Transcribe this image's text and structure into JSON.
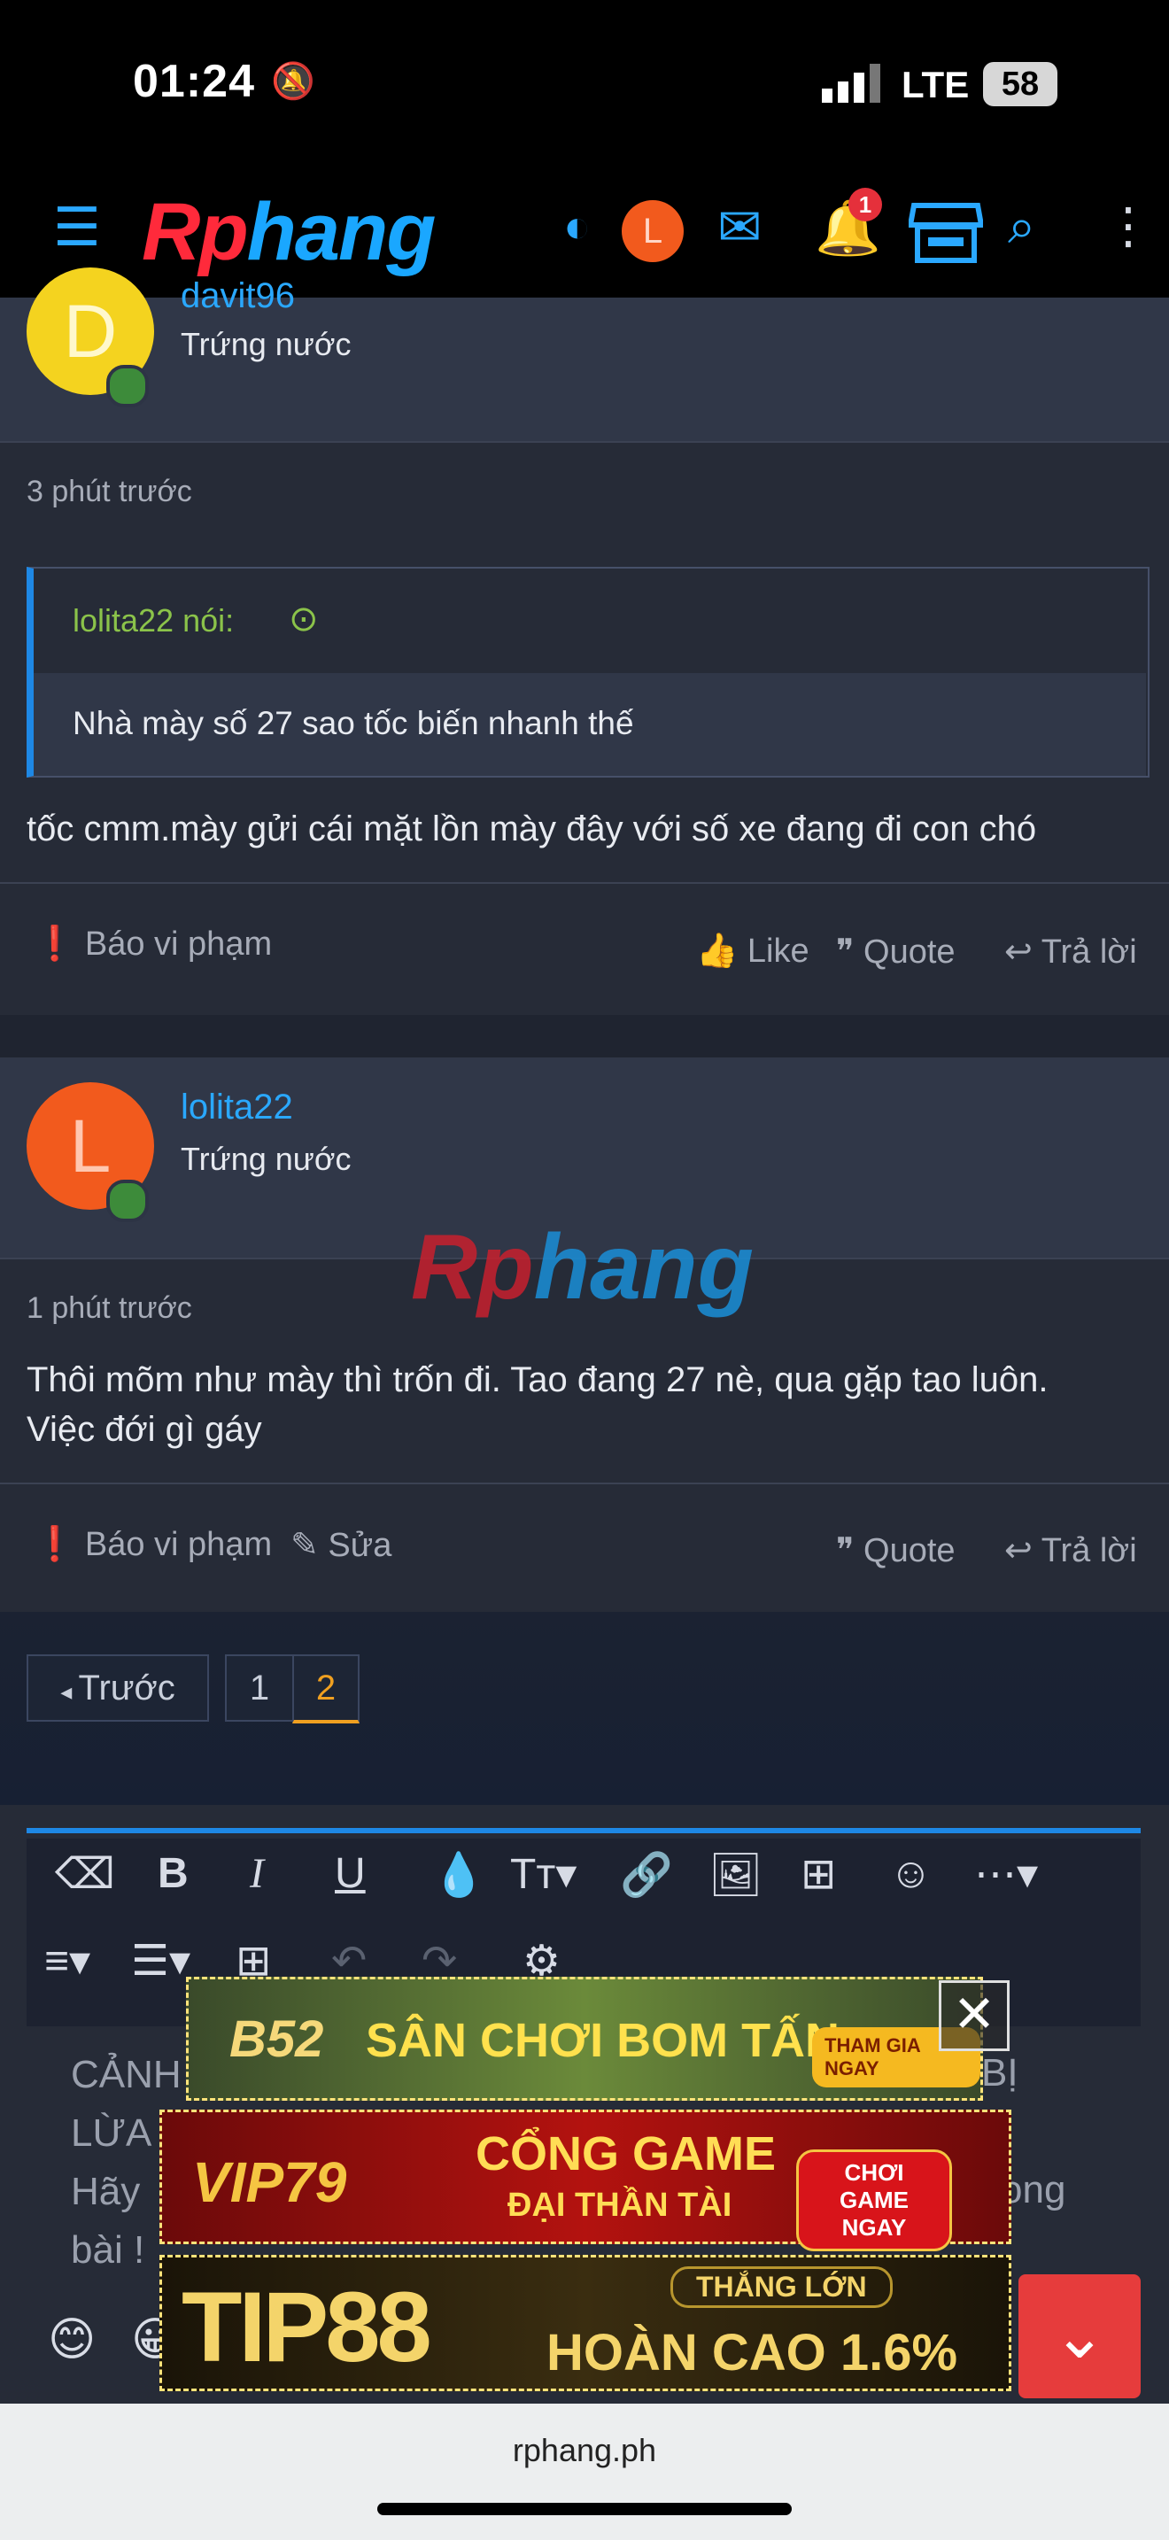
{
  "status": {
    "time": "01:24",
    "network": "LTE",
    "battery": "58"
  },
  "nav": {
    "logo_a": "Rp",
    "logo_b": "hang",
    "avatar_letter": "L",
    "notif_count": "1"
  },
  "post1": {
    "username": "davit96",
    "avatar_letter": "D",
    "rank": "Trứng nước",
    "time": "3 phút trước",
    "quote_author": "lolita22 nói:",
    "quote_text": "Nhà mày số 27 sao tốc biến nhanh thế",
    "message": "tốc cmm.mày gửi cái mặt lồn mày đây với số xe đang đi con chó",
    "report": "Báo vi phạm",
    "like": "Like",
    "quote": "Quote",
    "reply": "Trả lời"
  },
  "post2": {
    "username": "lolita22",
    "avatar_letter": "L",
    "rank": "Trứng nước",
    "time": "1 phút trước",
    "message_line1": "Thôi mõm như mày thì trốn đi. Tao đang 27 nè, qua gặp tao luôn.",
    "message_line2": "Việc đới gì gáy",
    "report": "Báo vi phạm",
    "edit": "Sửa",
    "quote": "Quote",
    "reply": "Trả lời"
  },
  "watermark": {
    "a": "Rp",
    "b": "hang"
  },
  "pagination": {
    "prev": "Trước",
    "pages": [
      "1",
      "2"
    ],
    "current": "2"
  },
  "editor": {
    "text_line1": "CẢNH",
    "text_line1_end": "BỊ",
    "text_line2": "LỪA",
    "text_line3": "Hãy",
    "text_line3_end": "ong",
    "text_line4": "bài !"
  },
  "ads": {
    "ad1_logo": "B52",
    "ad1_text": "SÂN CHƠI BOM TẤN",
    "ad1_btn": "THAM GIA NGAY",
    "ad2_logo": "VIP79",
    "ad2_text1": "CỔNG GAME",
    "ad2_text2": "ĐẠI THẦN TÀI",
    "ad2_btn": "CHƠI GAME NGAY",
    "ad3_logo": "TIP88",
    "ad3_tag": "THẮNG LỚN",
    "ad3_text": "HOÀN CAO 1.6%"
  },
  "browser": {
    "url": "rphang.ph"
  },
  "colors": {
    "accent": "#2aa8ff",
    "brand_red": "#ff2a3b",
    "online": "#3d8b3a"
  }
}
